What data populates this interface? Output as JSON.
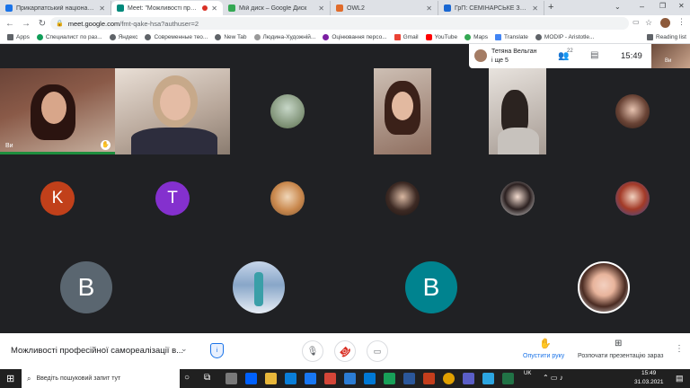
{
  "tabs": [
    {
      "title": "Прикарпатський національни",
      "color": "#1a73e8"
    },
    {
      "title": "Meet: \"Можливості профе",
      "color": "#00897b",
      "active": true
    },
    {
      "title": "Мій диск – Google Диск",
      "color": "#34a853"
    },
    {
      "title": "OWL2",
      "color": "#e06b2a"
    },
    {
      "title": "ГрП: СЕМІНАРСЬКЕ ЗАНЯТТЯ",
      "color": "#1967d2"
    }
  ],
  "new_tab": "+",
  "url": {
    "host": "meet.google.com",
    "path": "/fmt-qake-hsa?authuser=2"
  },
  "bookmarks": [
    {
      "label": "Apps",
      "color": "#5f6368"
    },
    {
      "label": "Специалист по раз...",
      "color": "#0f9d58"
    },
    {
      "label": "Яндекс",
      "color": "#5f6368"
    },
    {
      "label": "Современные тео...",
      "color": "#5f6368"
    },
    {
      "label": "New Tab",
      "color": "#5f6368"
    },
    {
      "label": "Людина-Художній...",
      "color": "#999999"
    },
    {
      "label": "Оцінювання персо...",
      "color": "#7b1fa2"
    },
    {
      "label": "Gmail",
      "color": "#ea4335"
    },
    {
      "label": "YouTube",
      "color": "#ff0000"
    },
    {
      "label": "Maps",
      "color": "#34a853"
    },
    {
      "label": "Translate",
      "color": "#4285f4"
    },
    {
      "label": "MODIP - Aristotle...",
      "color": "#5f6368"
    }
  ],
  "reading_list": "Reading list",
  "meet_top": {
    "presenter_name": "Тетяна Вельган",
    "presenter_more": "і ще 5",
    "participants_count": "22",
    "time": "15:49"
  },
  "self_label": "Ви",
  "letters": [
    "K",
    "T",
    "B",
    "B"
  ],
  "meeting_title": "Можливості професійної самореалізації в...",
  "raise_hand": "Опустити руку",
  "present_now": "Розпочати презентацію зараз",
  "taskbar": {
    "search_placeholder": "Введіть пошуковий запит тут",
    "lang": "UK",
    "time": "15:49",
    "date": "31.03.2021"
  }
}
